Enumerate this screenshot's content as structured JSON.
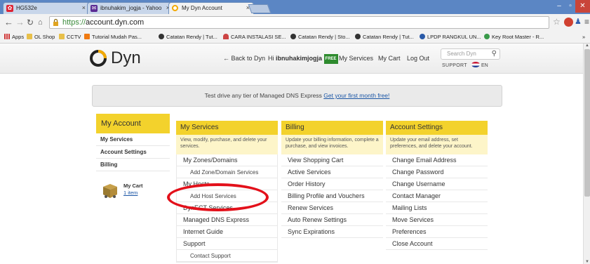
{
  "browser": {
    "tabs": [
      {
        "title": "HG532e",
        "active": false
      },
      {
        "title": "ibnuhakim_jogja - Yahoo",
        "active": false
      },
      {
        "title": "My Dyn Account",
        "active": true
      }
    ],
    "url_scheme": "https://",
    "url_rest": "account.dyn.com",
    "bookmarks": [
      {
        "label": "Apps",
        "icon": "apps-grid-icon"
      },
      {
        "label": "OL Shop",
        "icon": "folder-icon"
      },
      {
        "label": "CCTV",
        "icon": "folder-icon"
      },
      {
        "label": "Tutorial Mudah Pas...",
        "icon": "blogger-icon"
      },
      {
        "label": "Catatan Rendy | Tut...",
        "icon": "wordpress-icon"
      },
      {
        "label": "CARA INSTALASI SE...",
        "icon": "wifi-icon"
      },
      {
        "label": "Catatan Rendy | Sto...",
        "icon": "wordpress-icon"
      },
      {
        "label": "Catatan Rendy | Tut...",
        "icon": "wordpress-icon"
      },
      {
        "label": "LPDP RANGKUL UN...",
        "icon": "globe-icon"
      },
      {
        "label": "Key Root Master - R...",
        "icon": "key-icon"
      }
    ],
    "overflow": "»"
  },
  "header": {
    "logo_text": "Dyn",
    "back_link": "← Back to Dyn",
    "greeting": "Hi",
    "username": "ibnuhakimjogja",
    "badge": "FREE",
    "nav": [
      "My Services",
      "My Cart",
      "Log Out"
    ],
    "search_placeholder": "Search Dyn",
    "support": "SUPPORT",
    "lang": "EN"
  },
  "promo": {
    "text": "Test drive any tier of Managed DNS Express",
    "link": "Get your first month free!"
  },
  "sidebar": {
    "title": "My Account",
    "items": [
      "My Services",
      "Account Settings",
      "Billing"
    ],
    "cart_title": "My Cart",
    "cart_link": "1 item"
  },
  "columns": {
    "services": {
      "title": "My Services",
      "desc": "View, modify, purchase, and delete your services.",
      "items": [
        {
          "label": "My Zones/Domains",
          "sub": false
        },
        {
          "label": "Add Zone/Domain Services",
          "sub": true
        },
        {
          "label": "My Hosts",
          "sub": false
        },
        {
          "label": "Add Host Services",
          "sub": true
        },
        {
          "label": "DynECT Services",
          "sub": false
        },
        {
          "label": "Managed DNS Express",
          "sub": false
        },
        {
          "label": "Internet Guide",
          "sub": false
        },
        {
          "label": "Support",
          "sub": false
        },
        {
          "label": "Contact Support",
          "sub": true
        }
      ]
    },
    "billing": {
      "title": "Billing",
      "desc": "Update your billing information, complete a purchase, and view invoices.",
      "items": [
        "View Shopping Cart",
        "Active Services",
        "Order History",
        "Billing Profile and Vouchers",
        "Renew Services",
        "Auto Renew Settings",
        "Sync Expirations"
      ]
    },
    "settings": {
      "title": "Account Settings",
      "desc": "Update your email address, set preferences, and delete your account.",
      "items": [
        "Change Email Address",
        "Change Password",
        "Change Username",
        "Contact Manager",
        "Mailing Lists",
        "Move Services",
        "Preferences",
        "Close Account"
      ]
    }
  },
  "colors": {
    "accent_yellow": "#f3d22c",
    "annotation_red": "#e3101a",
    "link_blue": "#1a55a5"
  }
}
